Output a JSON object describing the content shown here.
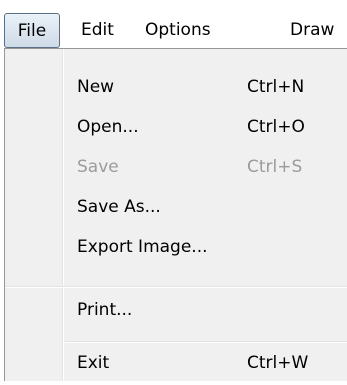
{
  "menubar": {
    "items": [
      {
        "label": "File",
        "selected": true
      },
      {
        "label": "Edit"
      },
      {
        "label": "Options"
      },
      {
        "label": "Draw"
      }
    ]
  },
  "file_menu": {
    "items": [
      {
        "label": "New",
        "shortcut": "Ctrl+N",
        "enabled": true
      },
      {
        "label": "Open...",
        "shortcut": "Ctrl+O",
        "enabled": true
      },
      {
        "label": "Save",
        "shortcut": "Ctrl+S",
        "enabled": false
      },
      {
        "label": "Save As...",
        "shortcut": "",
        "enabled": true
      },
      {
        "label": "Export Image...",
        "shortcut": "",
        "enabled": true
      },
      {
        "label": "Print...",
        "shortcut": "",
        "enabled": true
      },
      {
        "label": "Exit",
        "shortcut": "Ctrl+W",
        "enabled": true
      }
    ]
  },
  "colors": {
    "menu_background": "#f0f0f0",
    "disabled_text": "#9b9b9b",
    "selected_border": "#5b6f86"
  }
}
